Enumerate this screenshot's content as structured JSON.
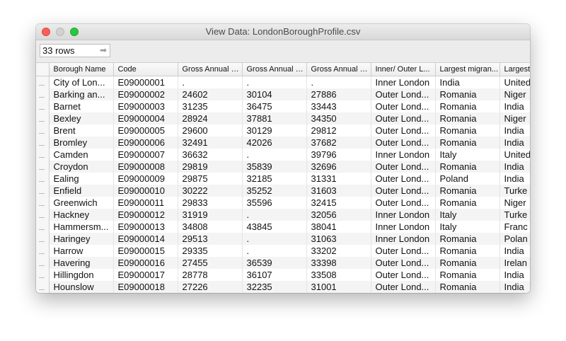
{
  "window": {
    "title": "View Data:  LondonBoroughProfile.csv"
  },
  "toolbar": {
    "row_count": "33 rows",
    "row_count_icon": "arrow-right-icon"
  },
  "table": {
    "columns": [
      "Borough Name",
      "Code",
      "Gross Annual P...",
      "Gross Annual P...",
      "Gross Annual P...",
      "Inner/ Outer L...",
      "Largest migran...",
      "Largest"
    ],
    "rows": [
      [
        "City of Lon...",
        "E09000001",
        ".",
        ".",
        ".",
        "Inner London",
        "India",
        "United"
      ],
      [
        "Barking an...",
        "E09000002",
        "24602",
        "30104",
        "27886",
        "Outer Lond...",
        "Romania",
        "Niger"
      ],
      [
        "Barnet",
        "E09000003",
        "31235",
        "36475",
        "33443",
        "Outer Lond...",
        "Romania",
        "India"
      ],
      [
        "Bexley",
        "E09000004",
        "28924",
        "37881",
        "34350",
        "Outer Lond...",
        "Romania",
        "Niger"
      ],
      [
        "Brent",
        "E09000005",
        "29600",
        "30129",
        "29812",
        "Outer Lond...",
        "Romania",
        "India"
      ],
      [
        "Bromley",
        "E09000006",
        "32491",
        "42026",
        "37682",
        "Outer Lond...",
        "Romania",
        "India"
      ],
      [
        "Camden",
        "E09000007",
        "36632",
        ".",
        "39796",
        "Inner London",
        "Italy",
        "United"
      ],
      [
        "Croydon",
        "E09000008",
        "29819",
        "35839",
        "32696",
        "Outer Lond...",
        "Romania",
        "India"
      ],
      [
        "Ealing",
        "E09000009",
        "29875",
        "32185",
        "31331",
        "Outer Lond...",
        "Poland",
        "India"
      ],
      [
        "Enfield",
        "E09000010",
        "30222",
        "35252",
        "31603",
        "Outer Lond...",
        "Romania",
        "Turke"
      ],
      [
        "Greenwich",
        "E09000011",
        "29833",
        "35596",
        "32415",
        "Outer Lond...",
        "Romania",
        "Niger"
      ],
      [
        "Hackney",
        "E09000012",
        "31919",
        ".",
        "32056",
        "Inner London",
        "Italy",
        "Turke"
      ],
      [
        "Hammersm...",
        "E09000013",
        "34808",
        "43845",
        "38041",
        "Inner London",
        "Italy",
        "Franc"
      ],
      [
        "Haringey",
        "E09000014",
        "29513",
        ".",
        "31063",
        "Inner London",
        "Romania",
        "Polan"
      ],
      [
        "Harrow",
        "E09000015",
        "29335",
        ".",
        "33202",
        "Outer Lond...",
        "Romania",
        "India"
      ],
      [
        "Havering",
        "E09000016",
        "27455",
        "36539",
        "33398",
        "Outer Lond...",
        "Romania",
        "Irelan"
      ],
      [
        "Hillingdon",
        "E09000017",
        "28778",
        "36107",
        "33508",
        "Outer Lond...",
        "Romania",
        "India"
      ],
      [
        "Hounslow",
        "E09000018",
        "27226",
        "32235",
        "31001",
        "Outer Lond...",
        "Romania",
        "India"
      ]
    ]
  }
}
